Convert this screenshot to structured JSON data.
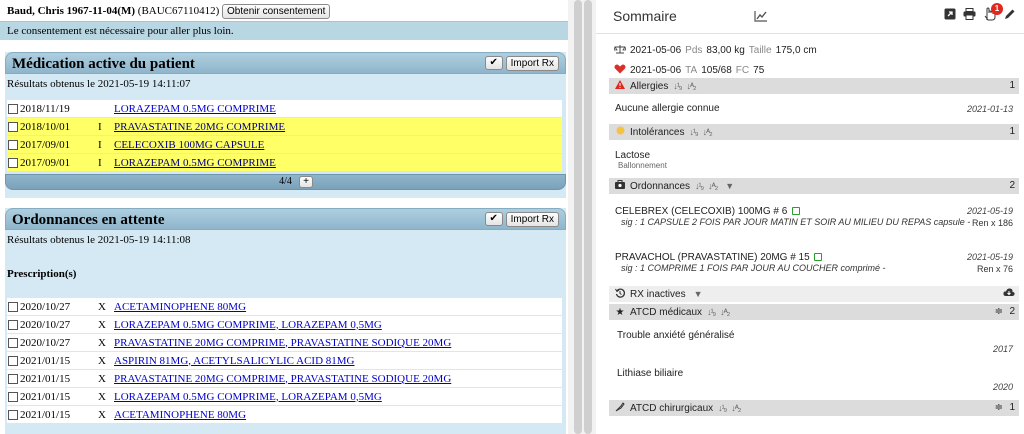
{
  "patient": {
    "header": "Baud, Chris 1967-11-04(M)",
    "code": "(BAUC67110412)",
    "consent_button": "Obtenir consentement",
    "consent_message": "Le consentement est nécessaire pour aller plus loin."
  },
  "medication": {
    "title": "Médication active du patient",
    "check_label": "✔",
    "import_label": "Import Rx",
    "results": "Résultats obtenus le 2021-05-19 14:11:07",
    "rows": [
      {
        "date": "2018/11/19",
        "flag": "",
        "drug": "LORAZEPAM 0.5MG COMPRIME",
        "highlight": false
      },
      {
        "date": "2018/10/01",
        "flag": "I",
        "drug": "PRAVASTATINE 20MG COMPRIME",
        "highlight": true
      },
      {
        "date": "2017/09/01",
        "flag": "I",
        "drug": "CELECOXIB 100MG CAPSULE",
        "highlight": true
      },
      {
        "date": "2017/09/01",
        "flag": "I",
        "drug": "LORAZEPAM 0.5MG COMPRIME",
        "highlight": true
      }
    ],
    "pager": "4/4",
    "plus_label": "+"
  },
  "pending": {
    "title": "Ordonnances en attente",
    "check_label": "✔",
    "import_label": "Import Rx",
    "results": "Résultats obtenus le 2021-05-19 14:11:08",
    "prescriptions_label": "Prescription(s)",
    "rows": [
      {
        "date": "2020/10/27",
        "flag": "X",
        "drug": "ACETAMINOPHENE 80MG"
      },
      {
        "date": "2020/10/27",
        "flag": "X",
        "drug": "LORAZEPAM 0.5MG COMPRIME, LORAZEPAM 0,5MG"
      },
      {
        "date": "2020/10/27",
        "flag": "X",
        "drug": "PRAVASTATINE 20MG COMPRIME, PRAVASTATINE SODIQUE 20MG"
      },
      {
        "date": "2021/01/15",
        "flag": "X",
        "drug": "ASPIRIN 81MG, ACETYLSALICYLIC ACID 81MG"
      },
      {
        "date": "2021/01/15",
        "flag": "X",
        "drug": "PRAVASTATINE 20MG COMPRIME, PRAVASTATINE SODIQUE 20MG"
      },
      {
        "date": "2021/01/15",
        "flag": "X",
        "drug": "LORAZEPAM 0.5MG COMPRIME, LORAZEPAM 0,5MG"
      },
      {
        "date": "2021/01/15",
        "flag": "X",
        "drug": "ACETAMINOPHENE 80MG"
      }
    ]
  },
  "summary": {
    "title": "Sommaire",
    "notif_count": "1",
    "weight": {
      "date": "2021-05-06",
      "pds_label": "Pds",
      "pds_value": "83,00 kg",
      "taille_label": "Taille",
      "taille_value": "175,0 cm"
    },
    "bp": {
      "date": "2021-05-06",
      "ta_label": "TA",
      "ta_value": "105/68",
      "fc_label": "FC",
      "fc_value": "75"
    },
    "allergies": {
      "label": "Allergies",
      "count": "1",
      "entry": "Aucune allergie connue",
      "date": "2021-01-13"
    },
    "intolerances": {
      "label": "Intolérances",
      "count": "1",
      "entry": "Lactose",
      "sub": "Ballonnement"
    },
    "ordonnances": {
      "label": "Ordonnances",
      "count": "2",
      "items": [
        {
          "name": "CELEBREX (CELECOXIB) 100MG # 6",
          "date": "2021-05-19",
          "sig": "sig : 1 CAPSULE 2 FOIS PAR JOUR MATIN ET SOIR AU MILIEU DU REPAS capsule -",
          "ren": "Ren x 186"
        },
        {
          "name": "PRAVACHOL (PRAVASTATINE) 20MG # 15",
          "date": "2021-05-19",
          "sig": "sig : 1 COMPRIME 1 FOIS PAR JOUR AU COUCHER comprimé -",
          "ren": "Ren x 76"
        }
      ]
    },
    "rx_inactives": {
      "label": "RX inactives"
    },
    "atcd_medicaux": {
      "label": "ATCD médicaux",
      "count": "2",
      "items": [
        {
          "name": "Trouble anxiété généralisé",
          "year": "2017"
        },
        {
          "name": "Lithiase biliaire",
          "year": "2020"
        }
      ]
    },
    "atcd_chirurgicaux": {
      "label": "ATCD chirurgicaux",
      "count": "1"
    }
  },
  "colors": {
    "panel_bg": "#d4e9f4",
    "highlight": "#ffff66",
    "link": "#0000cc",
    "badge": "#e0281e"
  }
}
